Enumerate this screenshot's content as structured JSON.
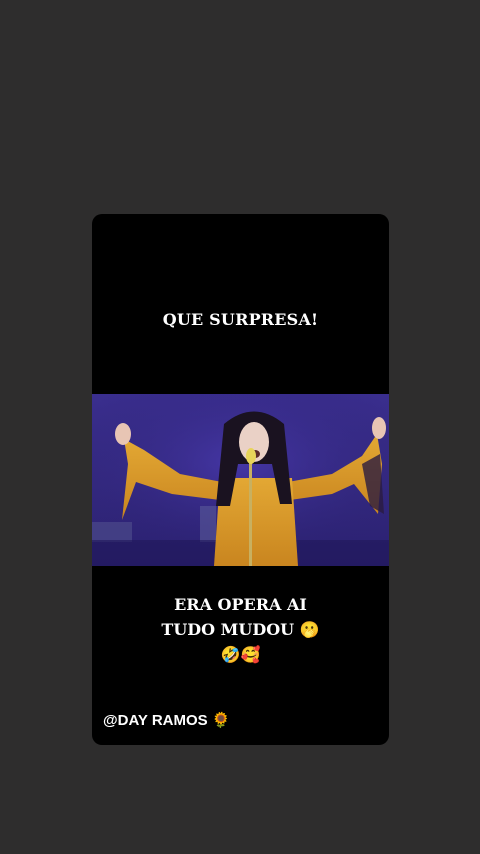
{
  "story": {
    "headline": "QUE SURPRESA!",
    "caption_line1": "ERA OPERA AI",
    "caption_line2": "TUDO MUDOU",
    "caption_line2_emoji": "🫢",
    "caption_line3_emoji": "🤣🥰",
    "credit": "@DAY RAMOS",
    "credit_emoji": "🌻"
  },
  "video": {
    "subject": "singer-in-gold-dress-with-microphone",
    "stage_color": "#35298a",
    "dress_color": "#d99a28"
  }
}
